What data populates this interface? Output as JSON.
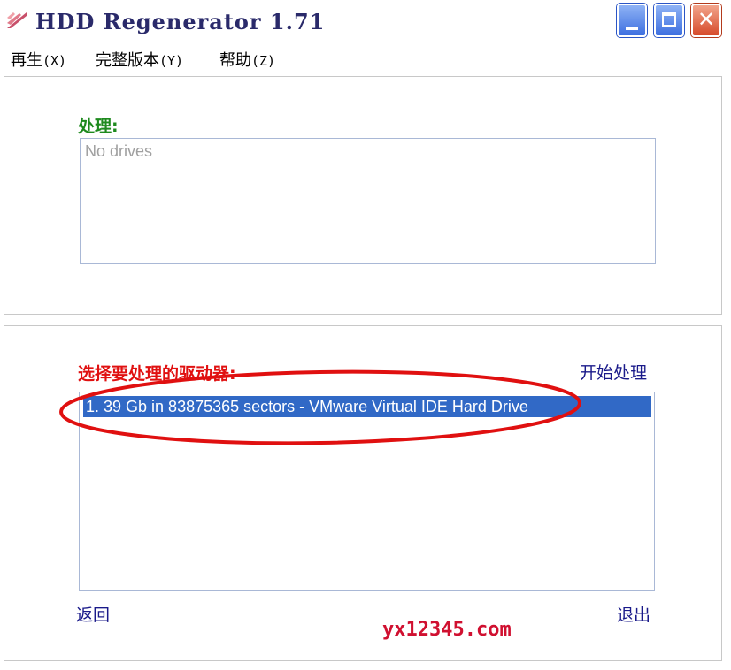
{
  "window": {
    "title": "HDD Regenerator 1.71",
    "close_glyph": "✕"
  },
  "menu": [
    {
      "label": "再生",
      "hotkey": "(X)"
    },
    {
      "label": "完整版本",
      "hotkey": "(Y)"
    },
    {
      "label": "帮助",
      "hotkey": "(Z)"
    }
  ],
  "processing": {
    "label": "处理:",
    "placeholder": "No drives"
  },
  "drive_select": {
    "label": "选择要处理的驱动器:",
    "start_link": "开始处理",
    "drives": [
      {
        "text": "1. 39 Gb in 83875365 sectors  -  VMware Virtual IDE Hard Drive",
        "selected": true
      }
    ],
    "highlight_color": "#e01010"
  },
  "footer": {
    "back": "返回",
    "exit": "退出",
    "watermark": "yx12345.com"
  },
  "colors": {
    "green_label": "#1e8a1e",
    "red_label": "#e01010",
    "link": "#1a1a8a",
    "selection": "#3169c6"
  },
  "icons": {
    "app": "hdd-regenerator-logo-icon",
    "minimize": "minimize-icon",
    "maximize": "maximize-icon",
    "close": "close-icon"
  }
}
